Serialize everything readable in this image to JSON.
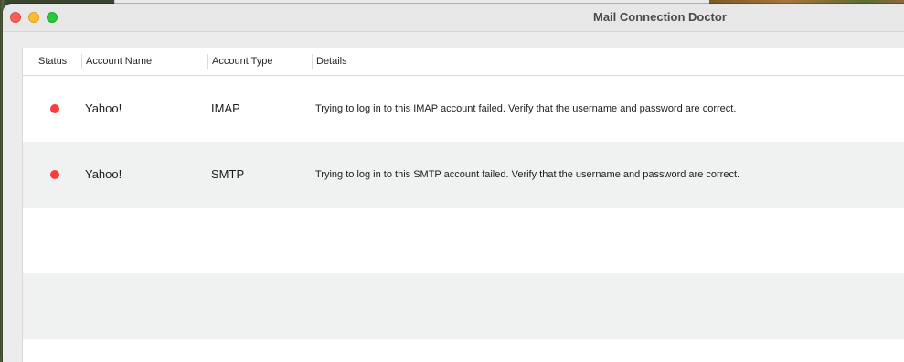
{
  "window": {
    "title": "Mail Connection Doctor"
  },
  "colors": {
    "status_error": "#fd3c3c",
    "row_alt": "#f0f1f1",
    "close": "#fe5f57",
    "minimize": "#febc2e",
    "zoom": "#28c840"
  },
  "table": {
    "columns": {
      "status": "Status",
      "account_name": "Account Name",
      "account_type": "Account Type",
      "details": "Details"
    },
    "rows": [
      {
        "status": "error",
        "account_name": "Yahoo!",
        "account_type": "IMAP",
        "details": "Trying to log in to this IMAP account failed. Verify that the username and password are correct."
      },
      {
        "status": "error",
        "account_name": "Yahoo!",
        "account_type": "SMTP",
        "details": "Trying to log in to this SMTP account failed. Verify that the username and password are correct."
      }
    ]
  }
}
